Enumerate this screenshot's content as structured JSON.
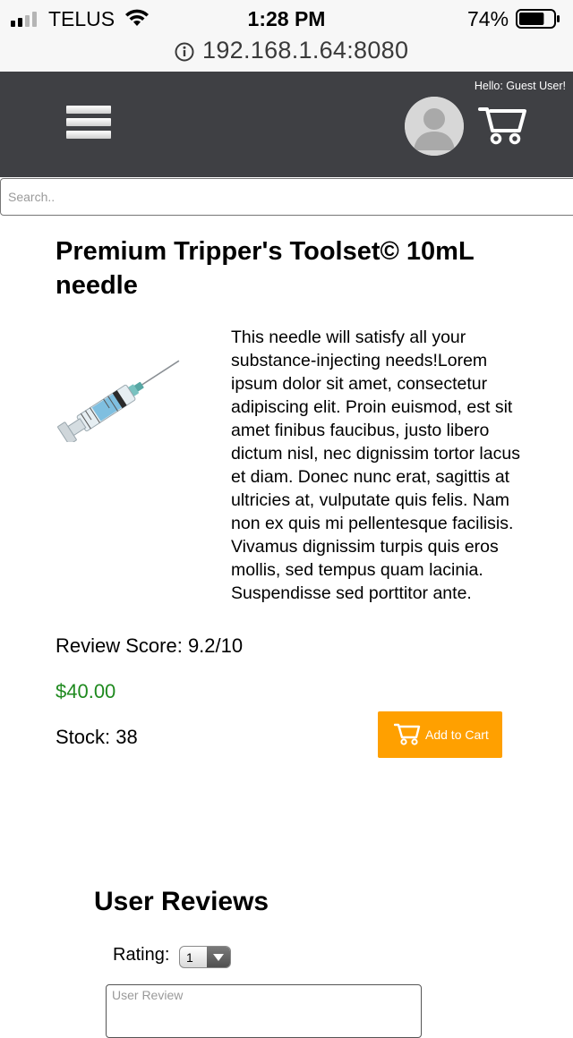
{
  "status_bar": {
    "carrier": "TELUS",
    "time": "1:28 PM",
    "battery_percent": "74%",
    "battery_level": 0.74,
    "icons": [
      "signal-icon",
      "wifi-icon",
      "battery-icon"
    ]
  },
  "browser": {
    "url": "192.168.1.64:8080",
    "icons": [
      "info-icon"
    ]
  },
  "header": {
    "greeting": "Hello: Guest User!",
    "icons": [
      "hamburger-menu-icon",
      "avatar-icon",
      "cart-icon"
    ],
    "background_color": "#3f4044"
  },
  "search": {
    "placeholder": "Search.."
  },
  "product": {
    "title": "Premium Tripper's Toolset© 10mL needle",
    "image_icon": "syringe-image",
    "description": "This needle will satisfy all your substance-injecting needs!Lorem ipsum dolor sit amet, consectetur adipiscing elit. Proin euismod, est sit amet finibus faucibus, justo libero dictum nisl, nec dignissim tortor lacus et diam. Donec nunc erat, sagittis at ultricies at, vulputate quis felis. Nam non ex quis mi pellentesque facilisis. Vivamus dignissim turpis quis eros mollis, sed tempus quam lacinia. Suspendisse sed porttitor ante.",
    "review_score": "Review Score: 9.2/10",
    "price": "$40.00",
    "price_color": "#1f8a1f",
    "stock": "Stock: 38",
    "add_to_cart_label": "Add to Cart",
    "add_to_cart_color": "#ffa000"
  },
  "reviews": {
    "heading": "User Reviews",
    "rating_label": "Rating:",
    "rating_value": "1",
    "review_placeholder": "User Review"
  }
}
